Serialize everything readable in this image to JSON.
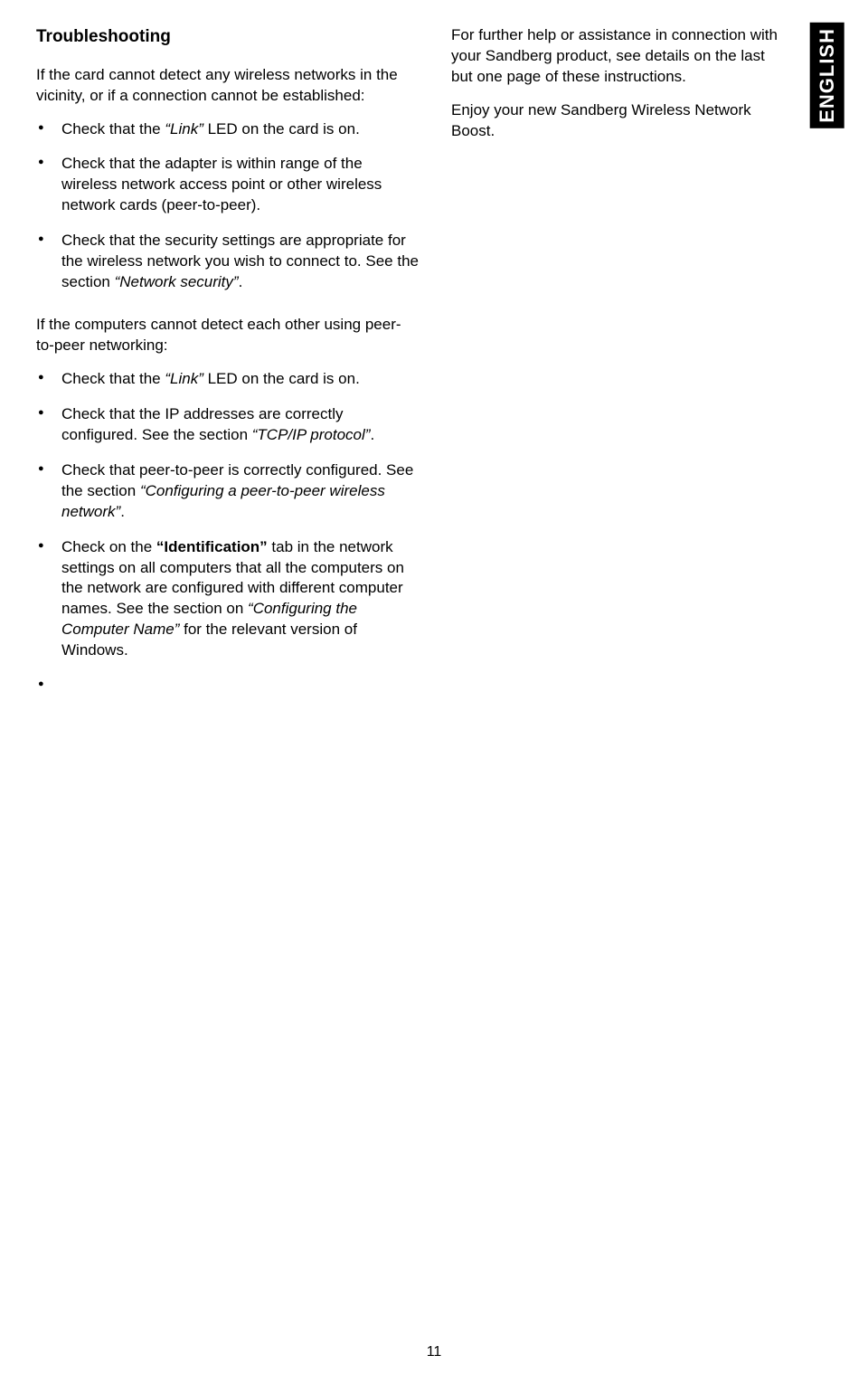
{
  "langTab": "ENGLISH",
  "pageNumber": "11",
  "left": {
    "heading": "Troubleshooting",
    "intro_parts": [
      "If the card cannot detect any wireless net­works in the vicinity, or if a connection cannot be established:"
    ],
    "list1": [
      [
        {
          "t": "Check that the "
        },
        {
          "t": "“Link”",
          "i": true
        },
        {
          "t": " LED on the card is on."
        }
      ],
      [
        {
          "t": "Check that the adapter is within range of the wireless network access point or other wireless network cards (peer-to-peer)."
        }
      ],
      [
        {
          "t": "Check that the security settings are appropriate for the wireless network you wish to connect to. See the section "
        },
        {
          "t": "“Network security”",
          "i": true
        },
        {
          "t": "."
        }
      ]
    ],
    "intro2": "If the computers cannot detect each other using peer-to-peer networking:",
    "list2": [
      [
        {
          "t": "Check that the "
        },
        {
          "t": "“Link”",
          "i": true
        },
        {
          "t": " LED on the card is on."
        }
      ],
      [
        {
          "t": "Check that the IP addresses are cor­rectly configured. See the section "
        },
        {
          "t": "“TCP/IP protocol”",
          "i": true
        },
        {
          "t": "."
        }
      ],
      [
        {
          "t": "Check that peer-to-peer is correctly configured. See the section "
        },
        {
          "t": "“Configuring a peer-to-peer wireless network”",
          "i": true
        },
        {
          "t": "."
        }
      ],
      [
        {
          "t": "Check on the "
        },
        {
          "t": "“Identification”",
          "b": true
        },
        {
          "t": " tab in the network settings on all computers that all the computers on the network are configured with different computer names. See the section on "
        },
        {
          "t": "“Configuring the Computer Name”",
          "i": true
        },
        {
          "t": " for the relevant version of Windows."
        }
      ],
      []
    ]
  },
  "right": {
    "p1": "For further help or assistance in connection with your Sandberg product, see details on the last but one page of these instructions.",
    "p2": "Enjoy your new Sandberg Wireless Network Boost."
  }
}
